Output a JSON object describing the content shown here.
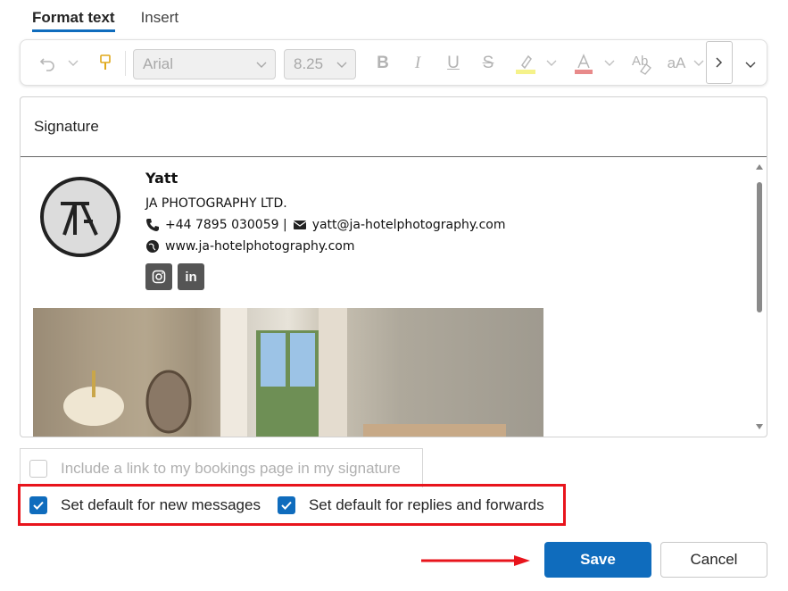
{
  "tabs": [
    {
      "label": "Format text",
      "active": true
    },
    {
      "label": "Insert",
      "active": false
    }
  ],
  "toolbar": {
    "font_name": "Arial",
    "font_size": "8.25",
    "change_case_label": "aA",
    "icons": [
      "undo-icon",
      "format-painter-icon",
      "bold-icon",
      "italic-icon",
      "underline-icon",
      "strikethrough-icon",
      "highlight-icon",
      "font-color-icon",
      "clear-formatting-icon",
      "change-case-icon",
      "more-icon",
      "expand-toolbar-icon"
    ],
    "highlight_color": "#f5f28a",
    "font_color": "#e88a8a"
  },
  "signature": {
    "name_label": "Signature",
    "person": "Yatt",
    "company": "JA PHOTOGRAPHY LTD.",
    "phone": "+44 7895 030059 |",
    "email": "yatt@ja-hotelphotography.com",
    "website": "www.ja-hotelphotography.com",
    "socials": [
      "instagram-icon",
      "linkedin-icon"
    ]
  },
  "options": {
    "bookings_label": "Include a link to my bookings page in my signature",
    "bookings_checked": false,
    "default_new_label": "Set default for new messages",
    "default_new_checked": true,
    "default_replies_label": "Set default for replies and forwards",
    "default_replies_checked": true
  },
  "buttons": {
    "save": "Save",
    "cancel": "Cancel"
  },
  "colors": {
    "accent": "#0f6cbd",
    "highlight_box": "#e8141c"
  }
}
